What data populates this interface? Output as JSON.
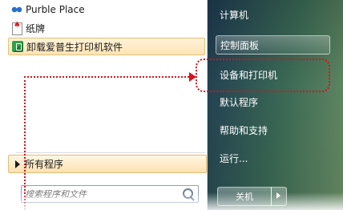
{
  "left": {
    "programs": [
      {
        "label": "Purble Place",
        "icon": "purble-place-icon"
      },
      {
        "label": "纸牌",
        "icon": "solitaire-icon"
      },
      {
        "label": "卸载爱普生打印机软件",
        "icon": "uninstall-icon",
        "selected": true
      }
    ],
    "all_programs_label": "所有程序",
    "search_placeholder": "搜索程序和文件"
  },
  "right": {
    "items": [
      {
        "label": "计算机"
      },
      {
        "label": "控制面板",
        "highlighted": true
      },
      {
        "label": "设备和打印机",
        "annotated": true
      },
      {
        "label": "默认程序"
      },
      {
        "label": "帮助和支持"
      },
      {
        "label": "运行..."
      }
    ],
    "shutdown_label": "关机"
  },
  "colors": {
    "annotation": "#d5141c",
    "selection": "#fde4b6",
    "right_panel": "#2f5a56"
  }
}
